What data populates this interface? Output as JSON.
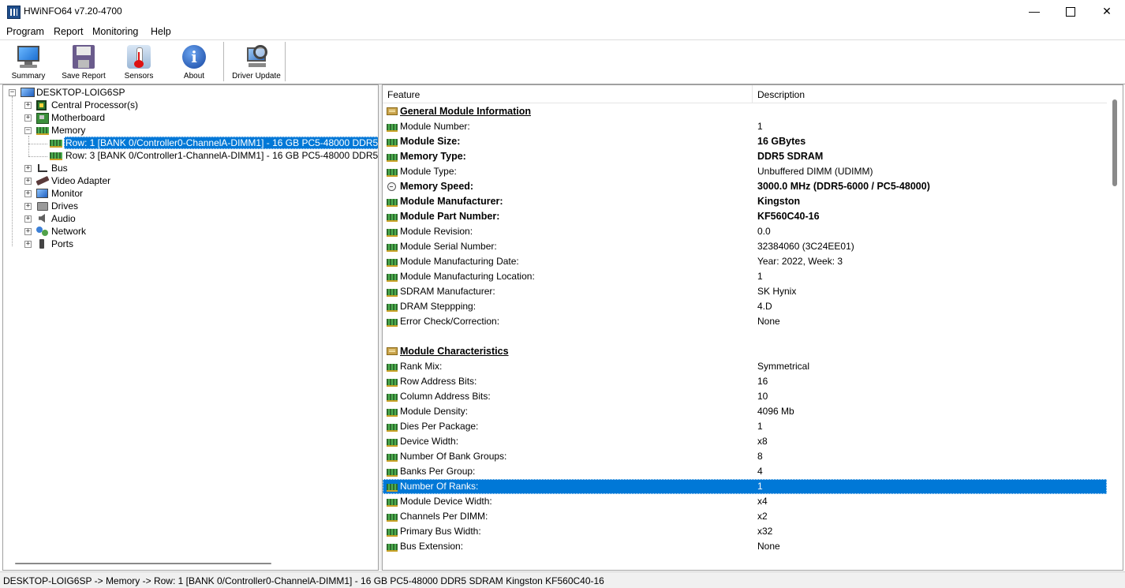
{
  "window": {
    "title": "HWiNFO64 v7.20-4700",
    "minimize_glyph": "—",
    "close_glyph": "✕"
  },
  "menu": [
    "Program",
    "Report",
    "Monitoring",
    "Help"
  ],
  "toolbar": {
    "buttons": [
      {
        "label": "Summary",
        "icon": "monitor-icon"
      },
      {
        "label": "Save Report",
        "icon": "floppy-disk-icon"
      },
      {
        "label": "Sensors",
        "icon": "thermometer-icon"
      },
      {
        "label": "About",
        "icon": "info-icon"
      },
      {
        "label": "Driver Update",
        "icon": "driver-update-icon"
      }
    ]
  },
  "tree": {
    "root": "DESKTOP-LOIG6SP",
    "expand_glyph": "+",
    "collapse_glyph": "−",
    "items": [
      {
        "label": "Central Processor(s)",
        "icon": "cpu-icon"
      },
      {
        "label": "Motherboard",
        "icon": "motherboard-icon"
      },
      {
        "label": "Memory",
        "icon": "memory-icon"
      },
      {
        "label": "Row: 1 [BANK 0/Controller0-ChannelA-DIMM1] - 16 GB PC5-48000 DDR5",
        "icon": "memory-module-icon"
      },
      {
        "label": "Row: 3 [BANK 0/Controller1-ChannelA-DIMM1] - 16 GB PC5-48000 DDR5",
        "icon": "memory-module-icon"
      },
      {
        "label": "Bus",
        "icon": "bus-icon"
      },
      {
        "label": "Video Adapter",
        "icon": "video-adapter-icon"
      },
      {
        "label": "Monitor",
        "icon": "monitor-icon"
      },
      {
        "label": "Drives",
        "icon": "drive-icon"
      },
      {
        "label": "Audio",
        "icon": "speaker-icon"
      },
      {
        "label": "Network",
        "icon": "network-icon"
      },
      {
        "label": "Ports",
        "icon": "port-icon"
      }
    ]
  },
  "table": {
    "col_feature": "Feature",
    "col_description": "Description",
    "rows": [
      {
        "feature": "General Module Information",
        "description": ""
      },
      {
        "feature": "Module Number:",
        "description": "1"
      },
      {
        "feature": "Module Size:",
        "description": "16 GBytes"
      },
      {
        "feature": "Memory Type:",
        "description": "DDR5 SDRAM"
      },
      {
        "feature": "Module Type:",
        "description": "Unbuffered DIMM (UDIMM)"
      },
      {
        "feature": "Memory Speed:",
        "description": "3000.0 MHz (DDR5-6000 / PC5-48000)"
      },
      {
        "feature": "Module Manufacturer:",
        "description": "Kingston"
      },
      {
        "feature": "Module Part Number:",
        "description": "KF560C40-16"
      },
      {
        "feature": "Module Revision:",
        "description": "0.0"
      },
      {
        "feature": "Module Serial Number:",
        "description": "32384060 (3C24EE01)"
      },
      {
        "feature": "Module Manufacturing Date:",
        "description": "Year: 2022, Week: 3"
      },
      {
        "feature": "Module Manufacturing Location:",
        "description": "1"
      },
      {
        "feature": "SDRAM Manufacturer:",
        "description": "SK Hynix"
      },
      {
        "feature": "DRAM Steppping:",
        "description": "4.D"
      },
      {
        "feature": "Error Check/Correction:",
        "description": "None"
      },
      {
        "feature": "Module Characteristics",
        "description": ""
      },
      {
        "feature": "Rank Mix:",
        "description": "Symmetrical"
      },
      {
        "feature": "Row Address Bits:",
        "description": "16"
      },
      {
        "feature": "Column Address Bits:",
        "description": "10"
      },
      {
        "feature": "Module Density:",
        "description": "4096 Mb"
      },
      {
        "feature": "Dies Per Package:",
        "description": "1"
      },
      {
        "feature": "Device Width:",
        "description": "x8"
      },
      {
        "feature": "Number Of Bank Groups:",
        "description": "8"
      },
      {
        "feature": "Banks Per Group:",
        "description": "4"
      },
      {
        "feature": "Number Of Ranks:",
        "description": "1"
      },
      {
        "feature": "Module Device Width:",
        "description": "x4"
      },
      {
        "feature": "Channels Per DIMM:",
        "description": "x2"
      },
      {
        "feature": "Primary Bus Width:",
        "description": "x32"
      },
      {
        "feature": "Bus Extension:",
        "description": "None"
      }
    ]
  },
  "status": {
    "text": "DESKTOP-LOIG6SP -> Memory -> Row: 1 [BANK 0/Controller0-ChannelA-DIMM1] - 16 GB PC5-48000 DDR5 SDRAM Kingston KF560C40-16"
  },
  "colors": {
    "selection": "#0078d7",
    "memory_icon": "#4caf50"
  }
}
